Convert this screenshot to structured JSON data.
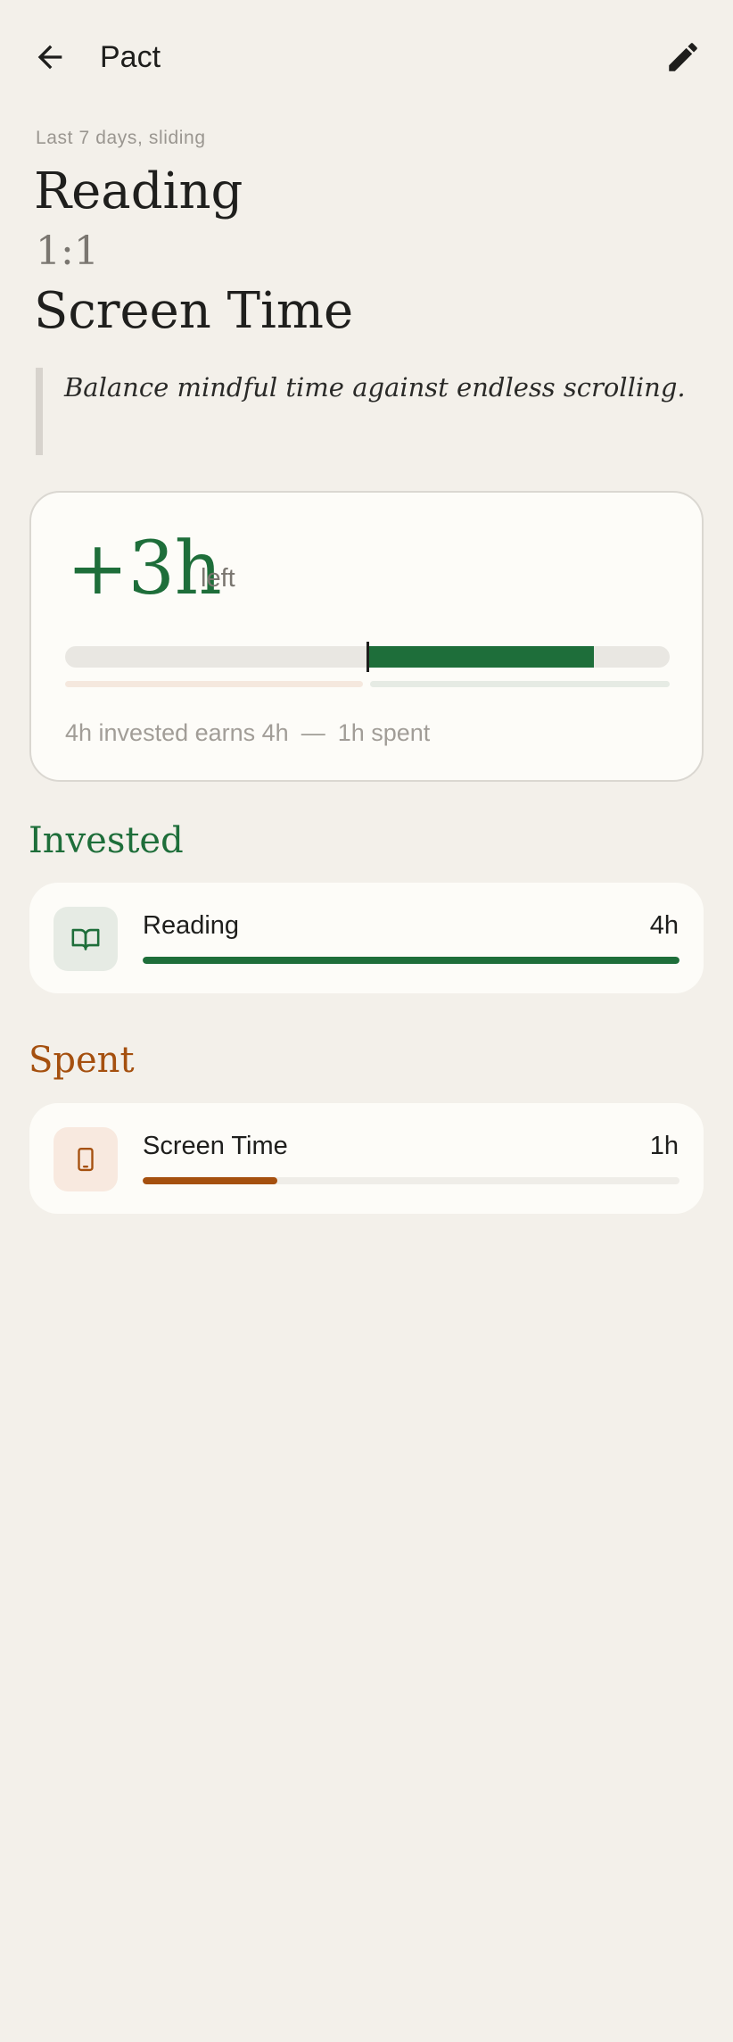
{
  "header": {
    "title": "Pact",
    "back_icon": "arrow-left-icon",
    "edit_icon": "pencil-icon"
  },
  "pact": {
    "window": "Last 7 days, sliding",
    "invest_activity": "Reading",
    "ratio": "1:1",
    "spend_activity": "Screen Time",
    "motto": "Balance mindful time against endless scrolling."
  },
  "summary": {
    "balance": "+3h",
    "balance_suffix": "left",
    "invested_text": "4h invested earns 4h",
    "separator": "—",
    "spent_text": "1h spent",
    "meter_fill_fraction": 0.75
  },
  "invested": {
    "title": "Invested",
    "items": [
      {
        "name": "Reading",
        "value": "4h",
        "icon": "book-icon",
        "fraction": 1.0
      }
    ]
  },
  "spent": {
    "title": "Spent",
    "items": [
      {
        "name": "Screen Time",
        "value": "1h",
        "icon": "phone-icon",
        "fraction": 0.25
      }
    ]
  },
  "colors": {
    "background": "#f3f0ea",
    "invested": "#1e6e3a",
    "spent": "#a5500f",
    "card": "#fdfcf8"
  }
}
